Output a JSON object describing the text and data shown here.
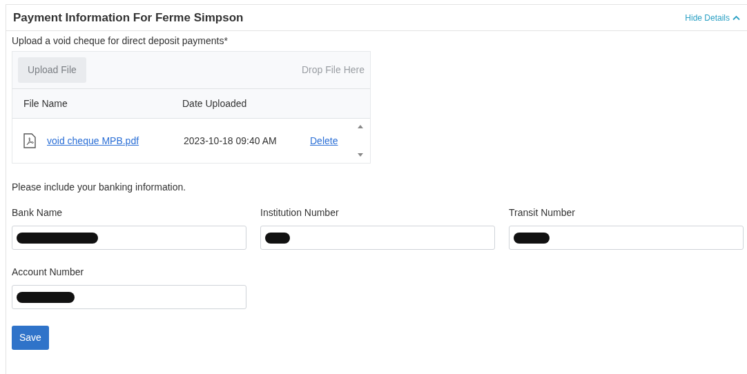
{
  "panel": {
    "title": "Payment Information For Ferme Simpson",
    "toggle": {
      "label": "Hide Details",
      "expanded": true
    }
  },
  "upload": {
    "label": "Upload a void cheque for direct deposit payments*",
    "button": "Upload File",
    "drop_hint": "Drop File Here",
    "columns": [
      "File Name",
      "Date Uploaded"
    ],
    "rows": [
      {
        "file": "void cheque MPB.pdf",
        "date": "2023-10-18 09:40 AM",
        "action": "Delete"
      }
    ]
  },
  "banking": {
    "note": "Please include your banking information.",
    "fields": [
      {
        "label": "Bank Name",
        "redacted": true
      },
      {
        "label": "Institution Number",
        "redacted": true
      },
      {
        "label": "Transit Number",
        "redacted": true
      },
      {
        "label": "Account Number",
        "redacted": true
      }
    ]
  },
  "save": "Save"
}
